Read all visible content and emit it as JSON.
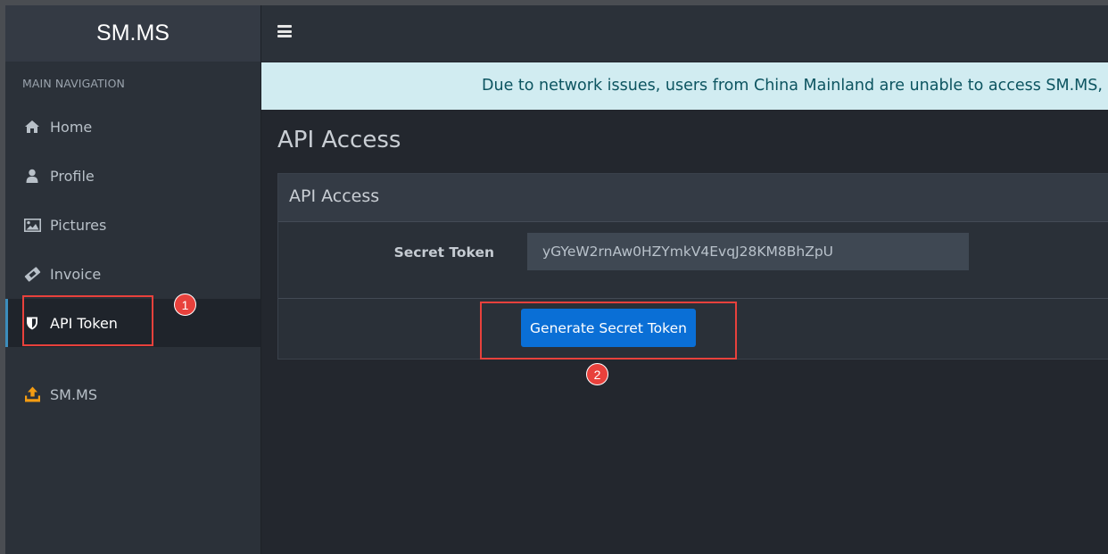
{
  "brand": "SM.MS",
  "sidebar": {
    "header": "MAIN NAVIGATION",
    "items": [
      {
        "label": "Home",
        "icon": "home-icon"
      },
      {
        "label": "Profile",
        "icon": "user-icon"
      },
      {
        "label": "Pictures",
        "icon": "image-icon"
      },
      {
        "label": "Invoice",
        "icon": "ticket-icon"
      },
      {
        "label": "API Token",
        "icon": "shield-icon",
        "active": true
      },
      {
        "label": "SM.MS",
        "icon": "upload-icon"
      }
    ]
  },
  "topbar": {
    "menu_icon": "hamburger-icon"
  },
  "alert": {
    "text": "Due to network issues, users from China Mainland are unable to access SM.MS, we ha"
  },
  "main": {
    "title": "API Access",
    "card": {
      "title": "API Access",
      "field_label": "Secret Token",
      "token_value": "yGYeW2rnAw0HZYmkV4EvqJ28KM8BhZpU",
      "button_label": "Generate Secret Token"
    }
  },
  "annotations": {
    "step1": "1",
    "step2": "2"
  },
  "colors": {
    "accent": "#0a6fd6",
    "alert_bg": "#d1ecf1",
    "alert_text": "#0c5460",
    "highlight": "#e8413c",
    "upload_icon": "#f39c12"
  }
}
